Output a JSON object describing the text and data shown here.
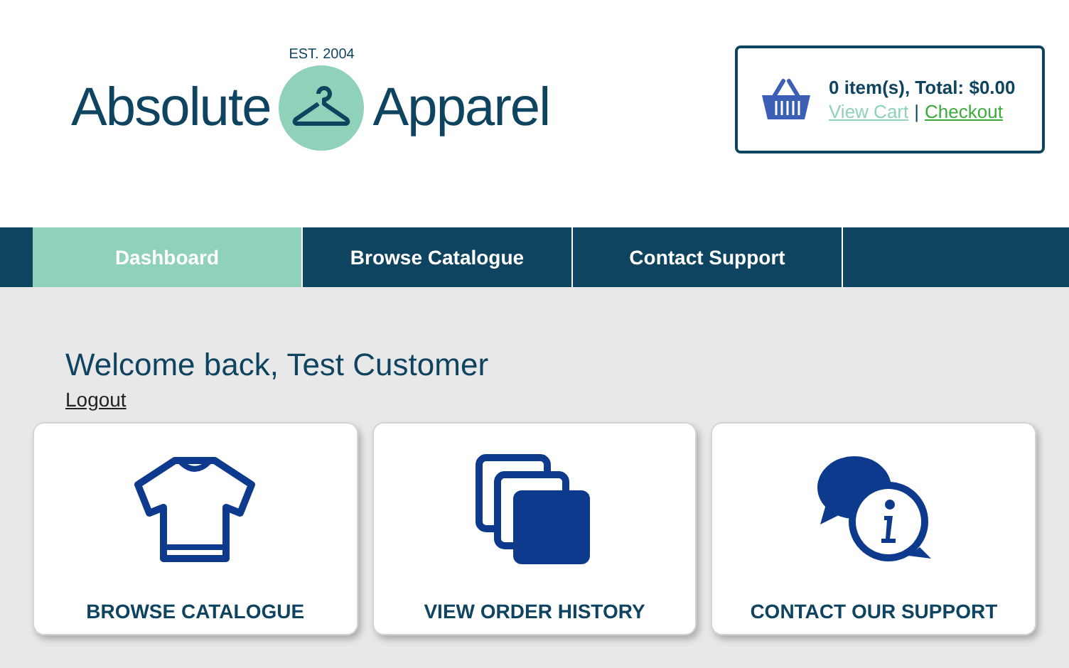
{
  "logo": {
    "word_left": "Absolute",
    "word_right": "Apparel",
    "tagline": "EST. 2004"
  },
  "cart": {
    "summary": "0 item(s), Total: $0.00",
    "view_cart": "View Cart",
    "separator": "|",
    "checkout": "Checkout"
  },
  "nav": [
    {
      "label": "Dashboard",
      "selected": true
    },
    {
      "label": "Browse Catalogue",
      "selected": false
    },
    {
      "label": "Contact Support",
      "selected": false
    }
  ],
  "welcome": "Welcome back, Test Customer",
  "logout": "Logout",
  "cards": [
    {
      "kind": "shirt",
      "label": "BROWSE CATALOGUE"
    },
    {
      "kind": "pages",
      "label": "VIEW ORDER HISTORY"
    },
    {
      "kind": "chat",
      "label": "CONTACT OUR SUPPORT"
    }
  ]
}
